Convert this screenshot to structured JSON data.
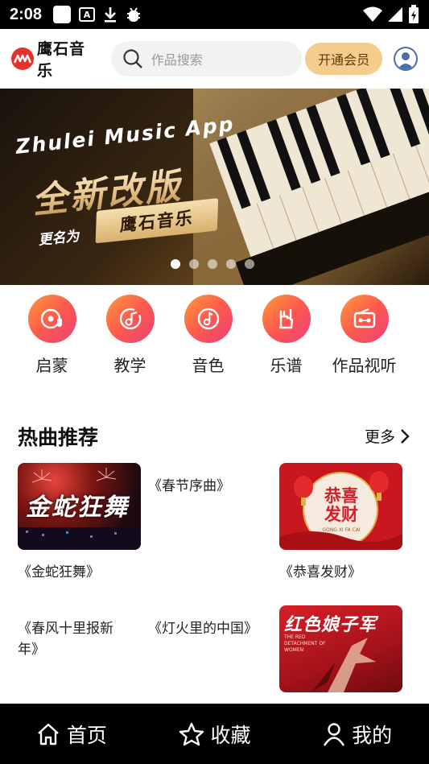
{
  "status_bar": {
    "time": "2:08",
    "a_label": "A"
  },
  "header": {
    "logo_text": "鹰石音乐",
    "search_placeholder": "作品搜索",
    "vip_label": "开通会员"
  },
  "banner": {
    "en_text": "Zhulei Music App",
    "title": "全新改版",
    "subtitle": "更名为",
    "badge": "鹰石音乐",
    "dots_total": 5,
    "active_dot": 0
  },
  "categories": [
    {
      "label": "启蒙",
      "icon": "disc-mic-icon"
    },
    {
      "label": "教学",
      "icon": "note-disc-icon"
    },
    {
      "label": "音色",
      "icon": "music-note-icon"
    },
    {
      "label": "乐谱",
      "icon": "rock-hand-icon"
    },
    {
      "label": "作品视听",
      "icon": "radio-icon"
    }
  ],
  "hot_section": {
    "title": "热曲推荐",
    "more_label": "更多"
  },
  "songs": [
    {
      "title": "《金蛇狂舞》",
      "thumb_text": "金蛇狂舞",
      "has_thumb": true
    },
    {
      "title": "《春节序曲》",
      "has_thumb": false
    },
    {
      "title": "《恭喜发财》",
      "thumb_text": "恭喜发财",
      "thumb_small": "GONG XI FA CAI",
      "has_thumb": true
    },
    {
      "title": "《春风十里报新年》",
      "has_thumb": false
    },
    {
      "title": "《灯火里的中国》",
      "has_thumb": false
    },
    {
      "title": "",
      "thumb_text": "红色娘子军",
      "thumb_small": "THE RED DETACHMENT OF WOMEN",
      "has_thumb": true
    }
  ],
  "bottom_nav": [
    {
      "label": "首页",
      "icon": "home-icon"
    },
    {
      "label": "收藏",
      "icon": "star-icon"
    },
    {
      "label": "我的",
      "icon": "user-icon"
    }
  ],
  "colors": {
    "accent": "#f6cc8c",
    "brand": "#e8302a",
    "category_gradient": [
      "#ff9a3c",
      "#f0407a"
    ]
  }
}
